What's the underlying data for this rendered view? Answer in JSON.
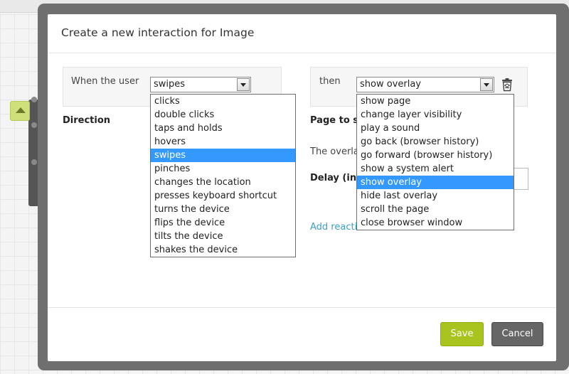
{
  "dialog": {
    "title": "Create a new interaction for Image"
  },
  "trigger": {
    "label": "When the user",
    "selected": "swipes",
    "options": [
      "clicks",
      "double clicks",
      "taps and holds",
      "hovers",
      "swipes",
      "pinches",
      "changes the location",
      "presses keyboard shortcut",
      "turns the device",
      "flips the device",
      "tilts the device",
      "shakes the device"
    ]
  },
  "action": {
    "label": "then",
    "selected": "show overlay",
    "options": [
      "show page",
      "change layer visibility",
      "play a sound",
      "go back (browser history)",
      "go forward (browser history)",
      "show a system alert",
      "show overlay",
      "hide last overlay",
      "scroll the page",
      "close browser window"
    ]
  },
  "fields": {
    "direction_label": "Direction",
    "page_to_label": "Page to s",
    "overlay_text": "The overla",
    "delay_label": "Delay (in",
    "add_reaction": "Add reaction"
  },
  "footer": {
    "save_label": "Save",
    "cancel_label": "Cancel"
  },
  "colors": {
    "accent_save": "#a9c41f",
    "selected_option": "#3399ff",
    "link": "#3aa0c8"
  },
  "icons": {
    "trash": "trash-icon",
    "dropdown_arrow": "chevron-down-icon",
    "up_arrow": "arrow-up-icon"
  }
}
